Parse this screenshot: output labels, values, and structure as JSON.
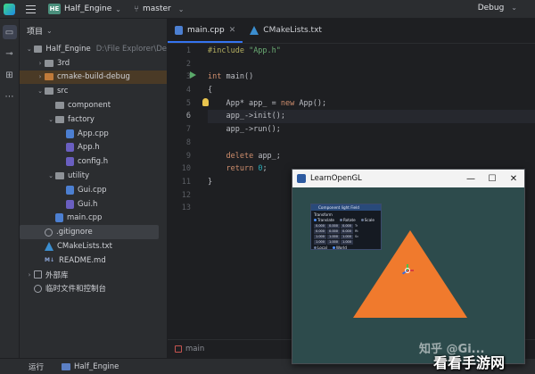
{
  "titlebar": {
    "project_badge": "HE",
    "project_name": "Half_Engine",
    "branch": "master",
    "run_config": "Debug"
  },
  "toolstrip": {
    "items": [
      "folder-icon",
      "commit-icon",
      "structure-icon",
      "more-icon"
    ]
  },
  "project_panel": {
    "title": "项目",
    "root_path": "D:\\File Explorer\\De",
    "tree": [
      {
        "label": "Half_Engine",
        "depth": 0,
        "arrow": "⌄",
        "type": "folder"
      },
      {
        "label": "3rd",
        "depth": 1,
        "arrow": "›",
        "type": "folder"
      },
      {
        "label": "cmake-build-debug",
        "depth": 1,
        "arrow": "›",
        "type": "folder-orange"
      },
      {
        "label": "src",
        "depth": 1,
        "arrow": "⌄",
        "type": "folder"
      },
      {
        "label": "component",
        "depth": 2,
        "arrow": "",
        "type": "folder"
      },
      {
        "label": "factory",
        "depth": 2,
        "arrow": "⌄",
        "type": "folder"
      },
      {
        "label": "App.cpp",
        "depth": 3,
        "arrow": "",
        "type": "cpp"
      },
      {
        "label": "App.h",
        "depth": 3,
        "arrow": "",
        "type": "h"
      },
      {
        "label": "config.h",
        "depth": 3,
        "arrow": "",
        "type": "h"
      },
      {
        "label": "utility",
        "depth": 2,
        "arrow": "⌄",
        "type": "folder"
      },
      {
        "label": "Gui.cpp",
        "depth": 3,
        "arrow": "",
        "type": "cpp"
      },
      {
        "label": "Gui.h",
        "depth": 3,
        "arrow": "",
        "type": "h"
      },
      {
        "label": "main.cpp",
        "depth": 2,
        "arrow": "",
        "type": "cpp"
      },
      {
        "label": ".gitignore",
        "depth": 1,
        "arrow": "",
        "type": "gitignore"
      },
      {
        "label": "CMakeLists.txt",
        "depth": 1,
        "arrow": "",
        "type": "cmake"
      },
      {
        "label": "README.md",
        "depth": 1,
        "arrow": "",
        "type": "md"
      },
      {
        "label": "外部库",
        "depth": 0,
        "arrow": "›",
        "type": "lib"
      },
      {
        "label": "临时文件和控制台",
        "depth": 0,
        "arrow": "",
        "type": "scratch"
      }
    ]
  },
  "editor": {
    "tabs": [
      {
        "label": "main.cpp",
        "active": true
      },
      {
        "label": "CMakeLists.txt",
        "active": false
      }
    ],
    "line_numbers": [
      "1",
      "2",
      "3",
      "4",
      "5",
      "6",
      "7",
      "8",
      "9",
      "10",
      "11",
      "12",
      "13"
    ],
    "current_line": 6,
    "code": [
      "#include \"App.h\"",
      "",
      "int main()",
      "{",
      "    App* app_ = new App();",
      "    app_->init();",
      "    app_->run();",
      "",
      "    delete app_;",
      "    return 0;",
      "}",
      "",
      ""
    ],
    "footer_file": "main"
  },
  "statusbar": {
    "run_label": "运行",
    "config_label": "Half_Engine"
  },
  "gl_window": {
    "title": "LearnOpenGL",
    "minimize": "—",
    "maximize": "☐",
    "close": "✕",
    "clear_color": "#2d4b4c",
    "triangle_color": "#f07a2d",
    "imgui": {
      "title": "Component light Field",
      "section": "Transform",
      "modes": [
        "Translate",
        "Rotate",
        "Scale"
      ],
      "matrix": [
        {
          "cells": [
            "0.000",
            "0.000",
            "0.000"
          ],
          "label": "Tr"
        },
        {
          "cells": [
            "0.000",
            "0.000",
            "0.000"
          ],
          "label": "Rt"
        },
        {
          "cells": [
            "1.000",
            "1.000",
            "1.000"
          ],
          "label": "Sc"
        },
        {
          "cells": [
            "1.000",
            "1.000",
            "1.000"
          ],
          "label": ""
        }
      ],
      "space_options": [
        "Local",
        "World"
      ]
    }
  },
  "watermark": {
    "zhihu": "知乎 @Gi...",
    "site": "看看手游网"
  }
}
